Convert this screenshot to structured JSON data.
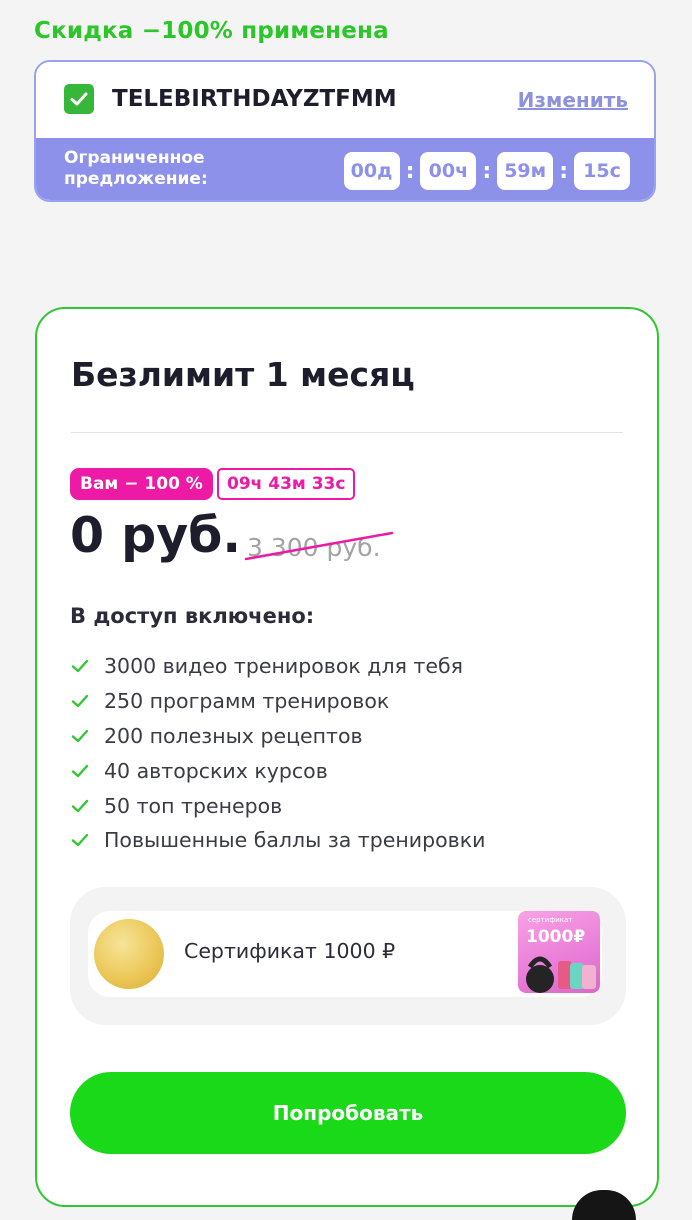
{
  "discount_banner": {
    "text": "Скидка −100% применена"
  },
  "promo": {
    "code": "TELEBIRTHDAYZTFMM",
    "change_label": "Изменить",
    "offer_label": "Ограниченное предложение:",
    "timer": {
      "days": "00д",
      "hours": "00ч",
      "minutes": "59м",
      "seconds": "15с",
      "separator": ":"
    }
  },
  "plan": {
    "title": "Безлимит 1 месяц",
    "discount_badge": "Вам − 100 %",
    "timer_badge": "09ч 43м 33с",
    "price": "0 руб.",
    "old_price": "3 300 руб.",
    "includes_title": "В доступ включено:",
    "features": [
      "3000 видео тренировок для тебя",
      "250 программ тренировок",
      "200 полезных рецептов",
      "40 авторских курсов",
      "50 топ тренеров",
      "Повышенные баллы за тренировки"
    ],
    "certificate": {
      "label": "Сертификат 1000 ₽",
      "image_caption": "сертификат",
      "image_amount": "1000₽"
    },
    "button_label": "Попробовать"
  },
  "colors": {
    "accent_green": "#2cc52a",
    "button_green": "#19d919",
    "promo_purple": "#8d91ea",
    "badge_pink": "#ec1aa4"
  }
}
